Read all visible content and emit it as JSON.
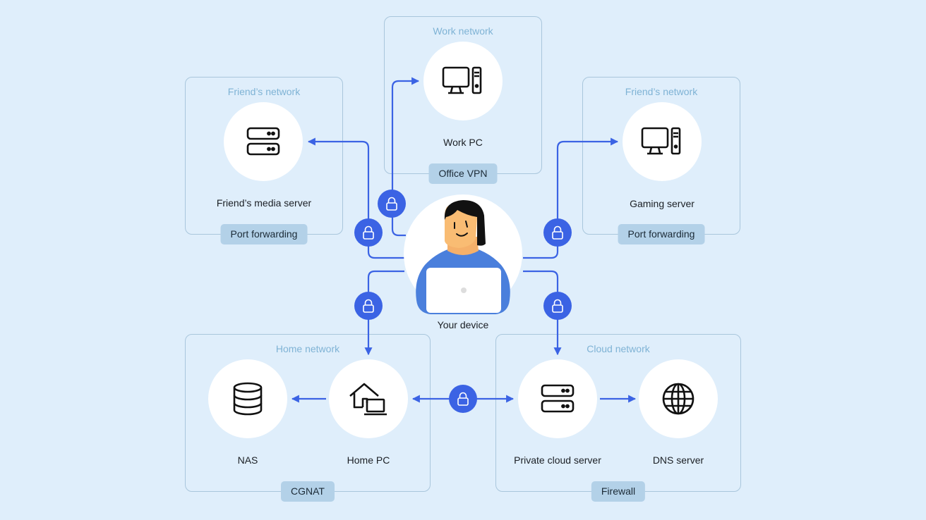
{
  "colors": {
    "background": "#dfeefb",
    "accent": "#3b63e4",
    "box_border": "#a9c6dc",
    "badge_bg": "#b3d1e8",
    "network_title": "#7fb3d5"
  },
  "networks": {
    "work": {
      "title": "Work network",
      "badge": "Office VPN",
      "nodes": [
        {
          "label": "Work PC",
          "icon": "desktop-computer-icon"
        }
      ]
    },
    "friend_left": {
      "title": "Friend’s network",
      "badge": "Port forwarding",
      "nodes": [
        {
          "label": "Friend’s media server",
          "icon": "server-icon"
        }
      ]
    },
    "friend_right": {
      "title": "Friend’s network",
      "badge": "Port forwarding",
      "nodes": [
        {
          "label": "Gaming server",
          "icon": "desktop-computer-icon"
        }
      ]
    },
    "home": {
      "title": "Home network",
      "badge": "CGNAT",
      "nodes": [
        {
          "label": "NAS",
          "icon": "database-icon"
        },
        {
          "label": "Home PC",
          "icon": "home-computer-icon"
        }
      ]
    },
    "cloud": {
      "title": "Cloud network",
      "badge": "Firewall",
      "nodes": [
        {
          "label": "Private cloud server",
          "icon": "server-icon"
        },
        {
          "label": "DNS server",
          "icon": "globe-icon"
        }
      ]
    }
  },
  "center": {
    "label": "Your device",
    "icon": "person-with-laptop"
  },
  "connections": [
    {
      "from": "Your device",
      "to": "Work PC",
      "secured": true
    },
    {
      "from": "Your device",
      "to": "Friend’s media server",
      "secured": true
    },
    {
      "from": "Your device",
      "to": "Gaming server",
      "secured": true
    },
    {
      "from": "Your device",
      "to": "Home PC",
      "secured": true
    },
    {
      "from": "Your device",
      "to": "Private cloud server",
      "secured": true
    },
    {
      "from": "Home PC",
      "to": "NAS",
      "secured": false
    },
    {
      "from": "Home PC",
      "to": "Private cloud server",
      "secured": true,
      "bidirectional": true
    },
    {
      "from": "Private cloud server",
      "to": "DNS server",
      "secured": false
    }
  ]
}
